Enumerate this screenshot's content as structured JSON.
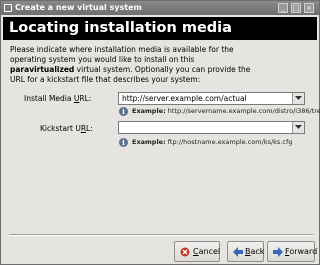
{
  "window": {
    "title": "Create a new virtual system",
    "controls": {
      "minimize": "_",
      "maximize": "□",
      "close": "×"
    }
  },
  "header": {
    "heading": "Locating installation media"
  },
  "description": {
    "line1": "Please indicate where installation media is available for the",
    "line2": "operating system you would like to install on this",
    "emph": "paravirtualized",
    "line3_rest": " virtual system. Optionally you can provide the",
    "line4": "URL for a kickstart file that describes your system:"
  },
  "install_media": {
    "label_pre": "Install Media ",
    "label_ul": "U",
    "label_post": "RL:",
    "value": "http://server.example.com/actual",
    "info_icon": "info-icon",
    "example_label": "Example:",
    "example_value": " http://servername.example.com/distro/i386/tree"
  },
  "kickstart": {
    "label_pre": "Kickstart U",
    "label_ul": "R",
    "label_post": "L:",
    "value": "",
    "info_icon": "info-icon",
    "example_label": "Example:",
    "example_value": " ftp://hostname.example.com/ks/ks.cfg"
  },
  "buttons": {
    "cancel": {
      "pre": "",
      "ul": "C",
      "post": "ancel",
      "icon": "cancel-icon"
    },
    "back": {
      "pre": "",
      "ul": "B",
      "post": "ack",
      "icon": "back-arrow-icon"
    },
    "forward": {
      "pre": "",
      "ul": "F",
      "post": "orward",
      "icon": "forward-arrow-icon"
    }
  }
}
